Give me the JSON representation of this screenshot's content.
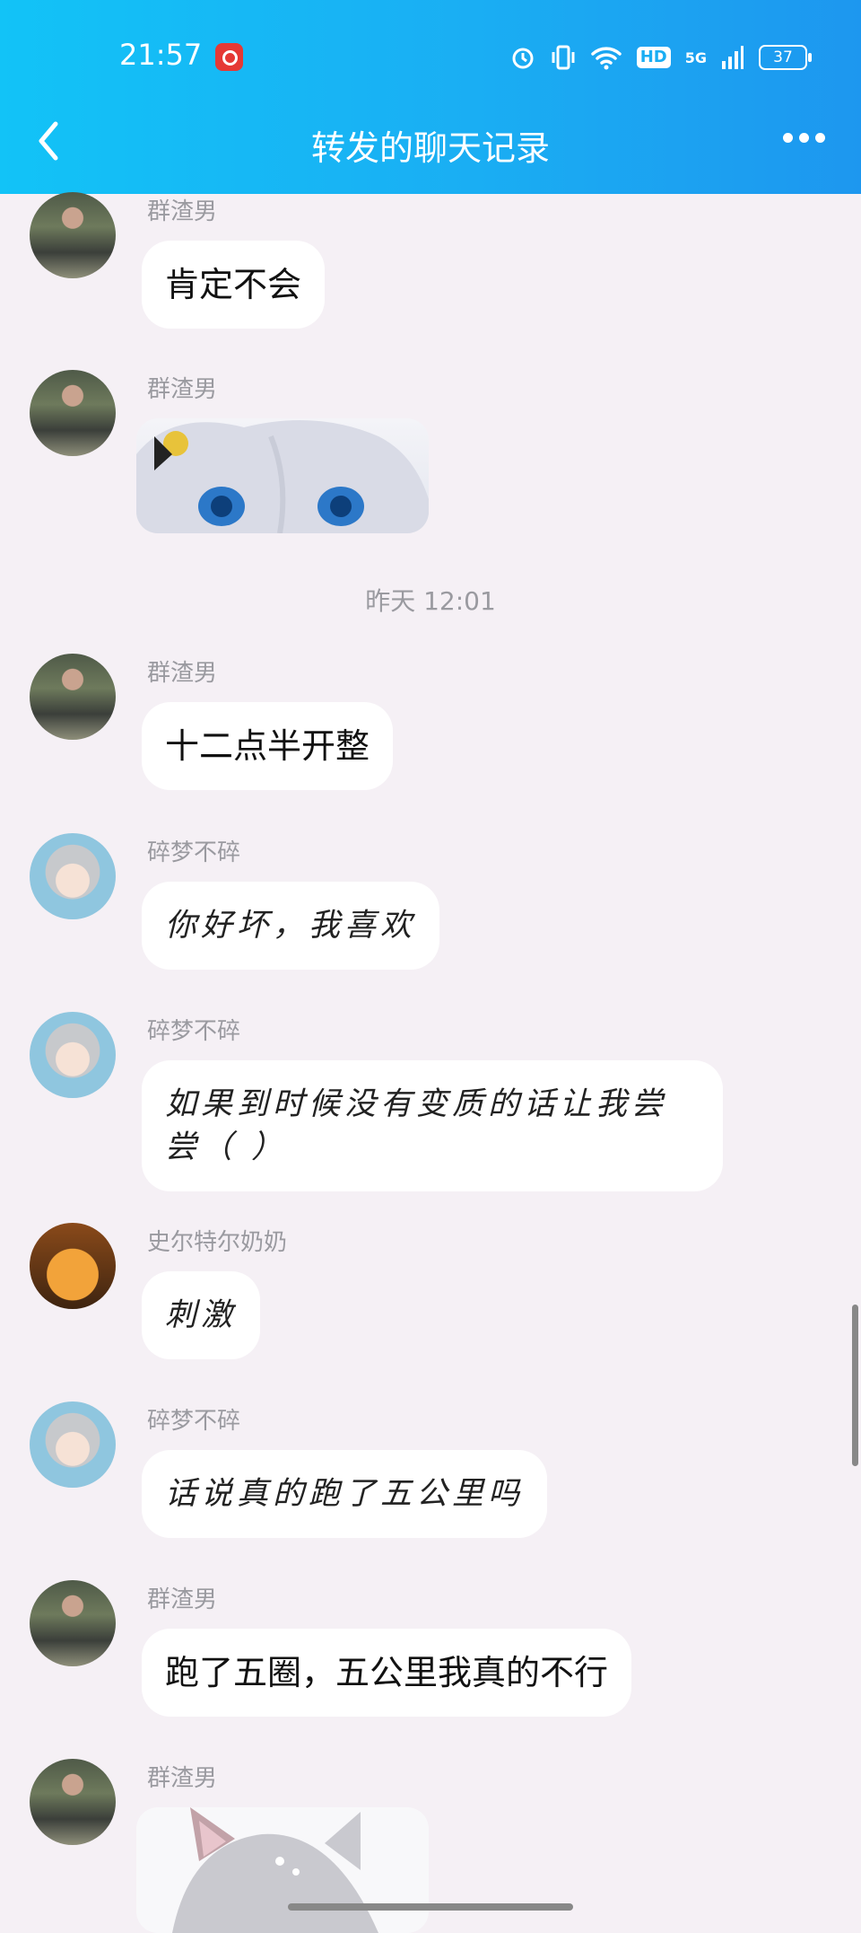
{
  "status_bar": {
    "time": "21:57",
    "app_icon": "netease-music-icon",
    "network": "5G",
    "hd": "HD",
    "battery": "37"
  },
  "header": {
    "title": "转发的聊天记录",
    "back_icon": "chevron-left-icon",
    "more_icon": "more-dots-icon"
  },
  "timestamp": "昨天 12:01",
  "messages": [
    {
      "sender": "群渣男",
      "text": "肯定不会"
    },
    {
      "sender": "群渣男",
      "sticker": "anime-girl-sticker"
    },
    {
      "sender": "群渣男",
      "text": "十二点半开整"
    },
    {
      "sender": "碎梦不碎",
      "text": "你好坏，我喜欢"
    },
    {
      "sender": "碎梦不碎",
      "text": "如果到时候没有变质的话让我尝尝（ ）"
    },
    {
      "sender": "史尔特尔奶奶",
      "text": "刺激"
    },
    {
      "sender": "碎梦不碎",
      "text": "话说真的跑了五公里吗"
    },
    {
      "sender": "群渣男",
      "text": "跑了五圈，五公里我真的不行"
    },
    {
      "sender": "群渣男",
      "sticker": "cat-girl-sticker"
    }
  ],
  "colors": {
    "header_start": "#12c3f7",
    "header_end": "#1d97ef",
    "background": "#f5f0f5",
    "bubble": "#ffffff",
    "name_text": "#9a9aa0"
  }
}
